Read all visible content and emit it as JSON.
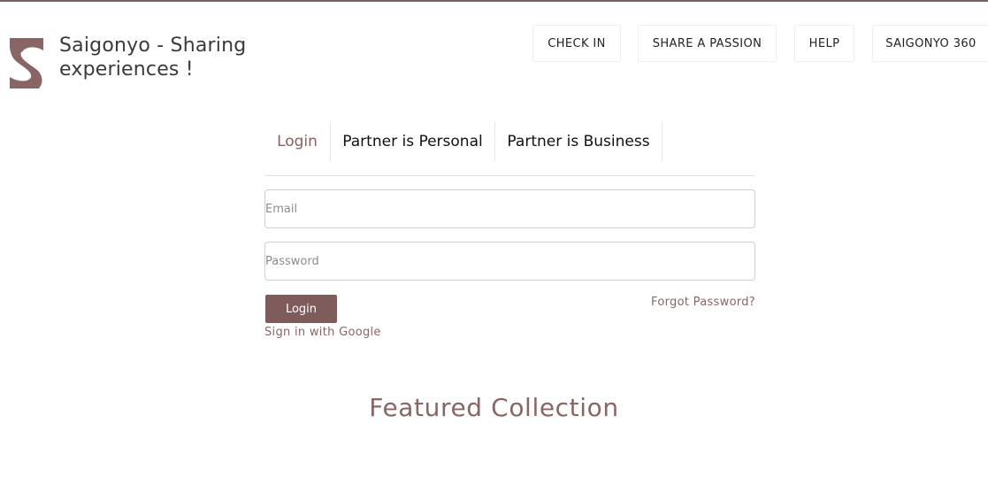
{
  "brand": {
    "title_line1": "Saigonyo - Sharing",
    "title_line2": "experiences !",
    "color": "#7e5c5c",
    "logo_icon": "saigonyo-s-logo"
  },
  "nav": {
    "items": [
      {
        "label": "CHECK IN"
      },
      {
        "label": "SHARE A PASSION"
      },
      {
        "label": "HELP"
      },
      {
        "label": "SAIGONYO 360"
      }
    ]
  },
  "tabs": [
    {
      "label": "Login",
      "active": true
    },
    {
      "label": "Partner is Personal",
      "active": false
    },
    {
      "label": "Partner is Business",
      "active": false
    }
  ],
  "form": {
    "email_placeholder": "Email",
    "email_value": "",
    "password_placeholder": "Password",
    "password_value": "",
    "login_label": "Login",
    "forgot_label": "Forgot Password?",
    "google_label": "Sign in with Google"
  },
  "featured": {
    "title": "Featured Collection"
  },
  "colors": {
    "accent": "#7e5c5c",
    "link": "#8a6565",
    "top_bar": "#7a6262"
  }
}
